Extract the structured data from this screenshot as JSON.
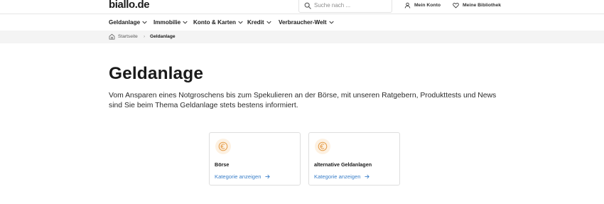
{
  "header": {
    "logo": "biallo.de",
    "search_placeholder": "Suche nach ...",
    "account_label": "Mein Konto",
    "library_label": "Meine Bibliothek"
  },
  "nav": {
    "items": [
      {
        "label": "Geldanlage"
      },
      {
        "label": "Immobilie"
      },
      {
        "label": "Konto & Karten"
      },
      {
        "label": "Kredit"
      },
      {
        "label": "Verbraucher-Welt"
      }
    ]
  },
  "breadcrumb": {
    "home": "Startseite",
    "separator": "›",
    "current": "Geldanlage"
  },
  "main": {
    "title": "Geldanlage",
    "intro": "Vom Ansparen eines Notgroschens bis zum Spekulieren an der Börse, mit unseren Ratgebern, Produkttests und News sind Sie beim Thema Geldanlage stets bestens informiert."
  },
  "cards": [
    {
      "title": "Börse",
      "link": "Kategorie anzeigen",
      "icon": "euro-icon"
    },
    {
      "title": "alternative Geldanlagen",
      "link": "Kategorie anzeigen",
      "icon": "euro-icon"
    }
  ],
  "colors": {
    "link": "#3a7fc9",
    "icon_accent": "#e6a04e",
    "icon_bg": "#fdf1e2",
    "breadcrumb_bg": "#f4f4f4"
  }
}
